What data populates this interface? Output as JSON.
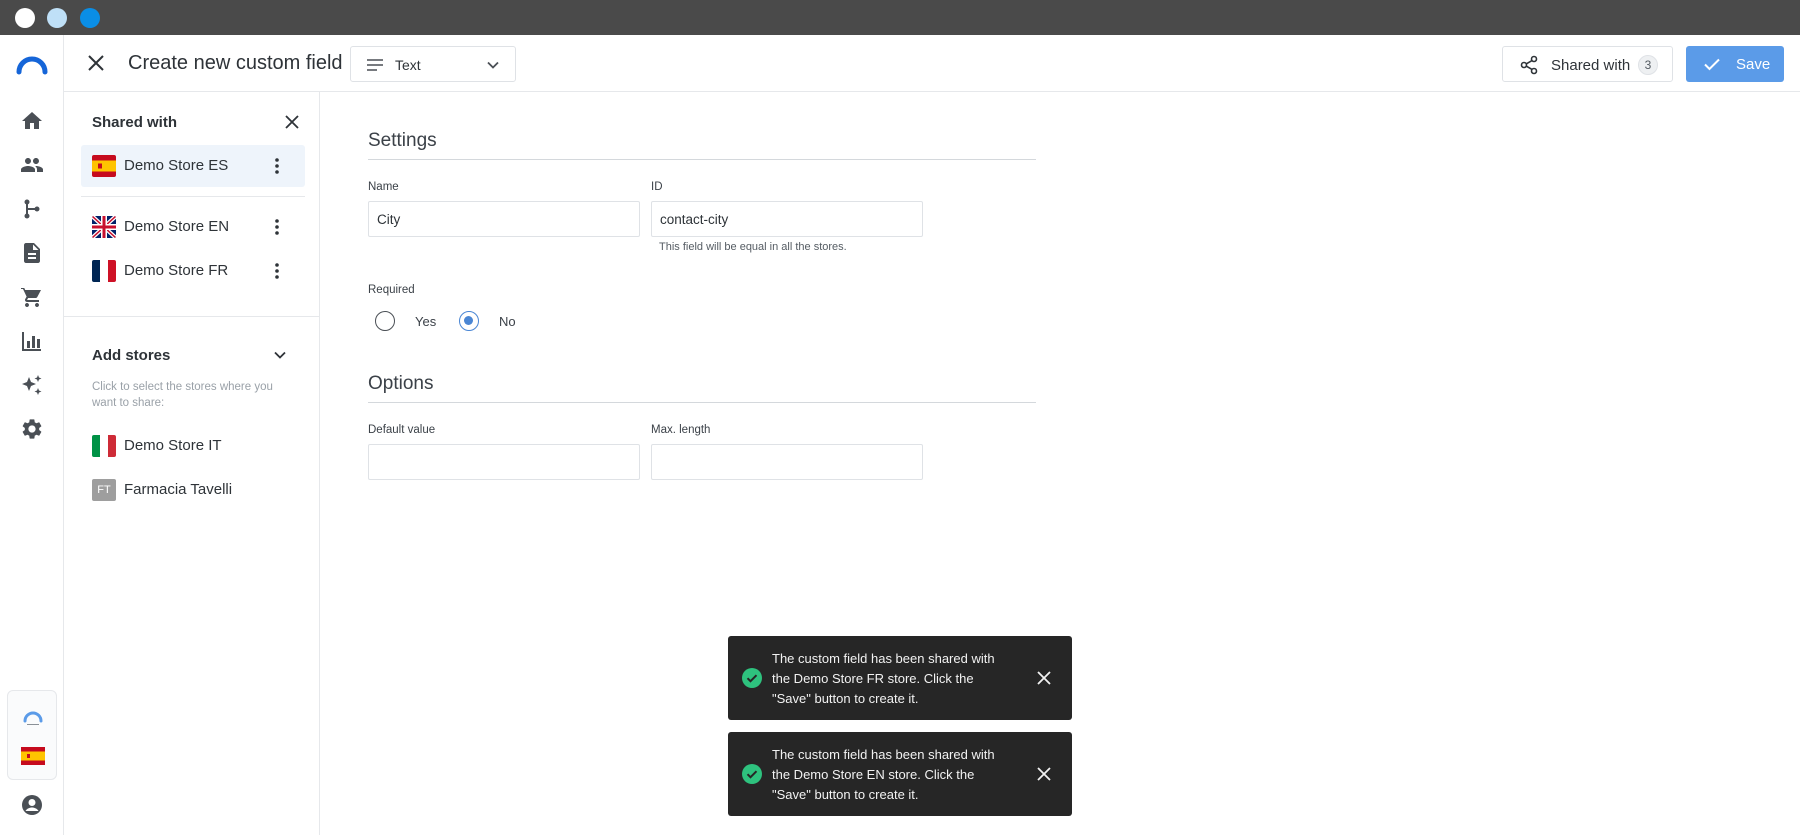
{
  "header": {
    "title": "Create new custom field",
    "type_value": "Text",
    "shared_label": "Shared with",
    "shared_count": "3",
    "save_label": "Save"
  },
  "panel": {
    "shared_title": "Shared with",
    "shared_stores": [
      {
        "name": "Demo Store ES",
        "flag": "es-flag"
      },
      {
        "name": "Demo Store EN",
        "flag": "uk-flag"
      },
      {
        "name": "Demo Store FR",
        "flag": "fr-flag"
      }
    ],
    "add_title": "Add stores",
    "add_hint": "Click to select the stores where you want to share:",
    "add_stores": [
      {
        "name": "Demo Store IT",
        "flag": "it-flag"
      },
      {
        "name": "Farmacia Tavelli",
        "badge": "FT"
      }
    ]
  },
  "form": {
    "settings_title": "Settings",
    "name_label": "Name",
    "name_value": "City",
    "id_label": "ID",
    "id_value": "contact-city",
    "id_help": "This field will be equal in all the stores.",
    "required_label": "Required",
    "yes_label": "Yes",
    "no_label": "No",
    "options_title": "Options",
    "default_label": "Default value",
    "default_value": "",
    "maxlen_label": "Max. length",
    "maxlen_value": ""
  },
  "toasts": [
    {
      "message": "The custom field has been shared with the Demo Store FR store. Click the \"Save\" button to create it."
    },
    {
      "message": "The custom field has been shared with the Demo Store EN store. Click the \"Save\" button to create it."
    }
  ],
  "colors": {
    "accent": "#5b9be8",
    "toast_bg": "#262626",
    "success": "#2ec27e"
  }
}
